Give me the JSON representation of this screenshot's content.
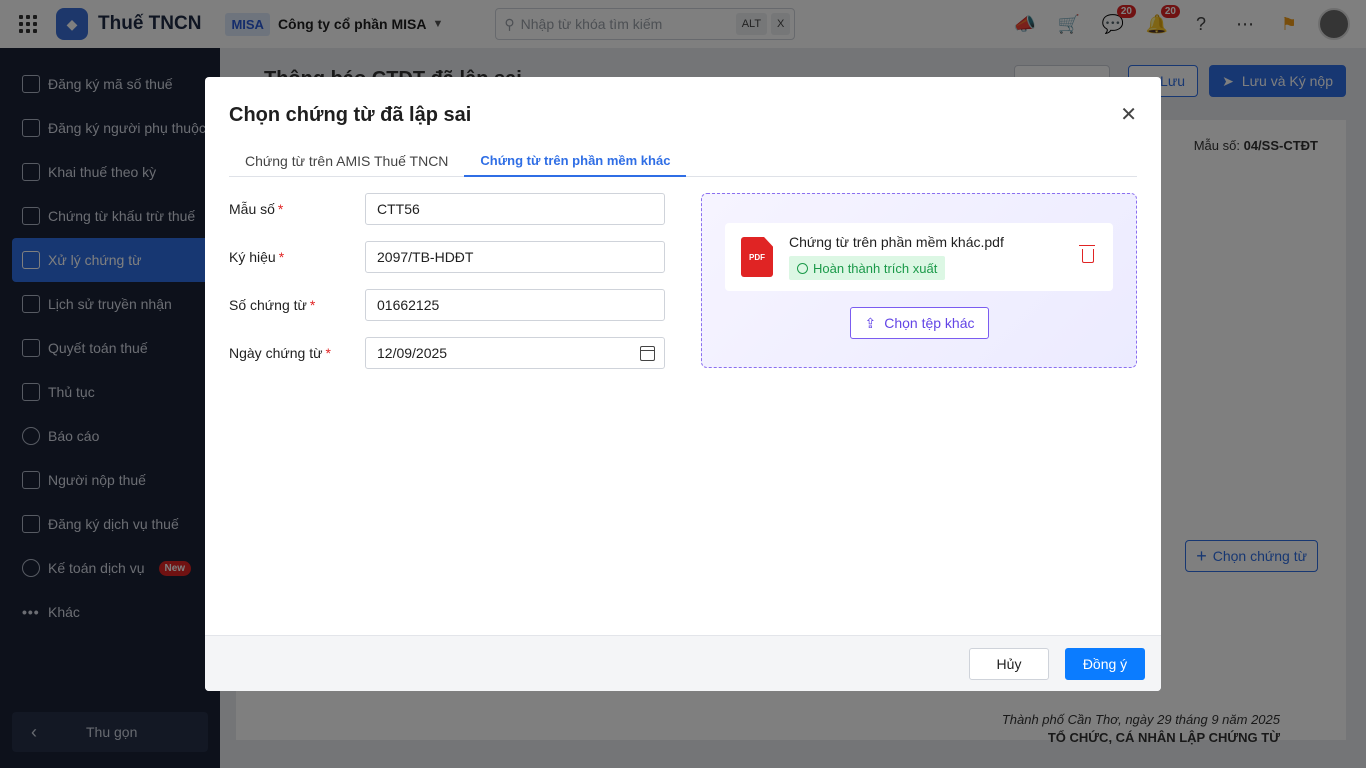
{
  "topbar": {
    "app_title": "Thuế TNCN",
    "company_tag": "MISA",
    "company_name": "Công ty cổ phần MISA",
    "search_placeholder": "Nhập từ khóa tìm kiếm",
    "kbd_alt": "ALT",
    "kbd_x": "X",
    "chat_badge": "20",
    "bell_badge": "20"
  },
  "sidebar": {
    "items": [
      {
        "label": "Đăng ký mã số thuế"
      },
      {
        "label": "Đăng ký người phụ thuộc"
      },
      {
        "label": "Khai thuế theo kỳ"
      },
      {
        "label": "Chứng từ khấu trừ thuế"
      },
      {
        "label": "Xử lý chứng từ"
      },
      {
        "label": "Lịch sử truyền nhận"
      },
      {
        "label": "Quyết toán thuế"
      },
      {
        "label": "Thủ tục"
      },
      {
        "label": "Báo cáo"
      },
      {
        "label": "Người nộp thuế"
      },
      {
        "label": "Đăng ký dịch vụ thuế"
      },
      {
        "label": "Kế toán dịch vụ"
      },
      {
        "label": "Khác"
      }
    ],
    "new_badge": "New",
    "collapse_label": "Thu gọn"
  },
  "background": {
    "title": "Thông báo CTĐT đã lập sai",
    "save_label": "Lưu",
    "save_submit_label": "Lưu và Ký nộp",
    "form_no_prefix": "Mẫu số:",
    "form_no": "04/SS-CTĐT",
    "choose_doc_label": "Chọn chứng từ",
    "footer_place_date": "Thành phố Cần Thơ, ngày 29 tháng 9 năm 2025",
    "footer_org": "TỔ CHỨC, CÁ NHÂN LẬP CHỨNG TỪ"
  },
  "dialog": {
    "title": "Chọn chứng từ đã lập sai",
    "tabs": [
      {
        "label": "Chứng từ trên AMIS Thuế TNCN"
      },
      {
        "label": "Chứng từ trên phần mềm khác"
      }
    ],
    "fields": [
      {
        "label": "Mẫu số",
        "value": "CTT56"
      },
      {
        "label": "Ký hiệu",
        "value": "2097/TB-HDĐT"
      },
      {
        "label": "Số chứng từ",
        "value": "01662125"
      },
      {
        "label": "Ngày chứng từ",
        "value": "12/09/2025"
      }
    ],
    "required_mark": "*",
    "file": {
      "name": "Chứng từ trên phần mềm khác.pdf",
      "icon_text": "PDF",
      "status": "Hoàn thành trích xuất"
    },
    "choose_other_file": "Chọn tệp khác",
    "cancel_label": "Hủy",
    "ok_label": "Đồng ý"
  },
  "colors": {
    "accent": "#2f6ee5",
    "sidebar_bg": "#1a2236",
    "danger": "#e02424",
    "success": "#1b9a4a",
    "upload_accent": "#7b5cf0"
  }
}
